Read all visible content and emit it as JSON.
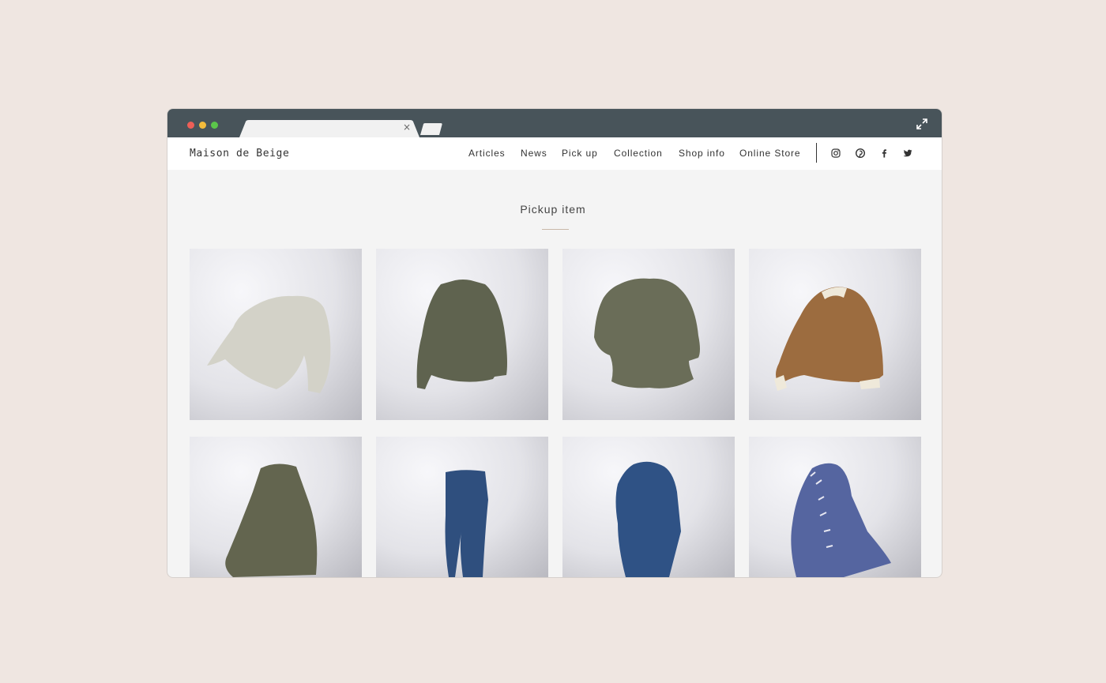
{
  "browser": {
    "tab_close_glyph": "×"
  },
  "site": {
    "brand": "Maison de Beige",
    "nav": [
      "Articles",
      "News",
      "Pick up",
      "Collection",
      "Shop info",
      "Online Store"
    ],
    "social_icons": [
      "instagram-icon",
      "pinterest-icon",
      "facebook-icon",
      "twitter-icon"
    ]
  },
  "section": {
    "title": "Pickup item"
  },
  "products": [
    {
      "name": "knit-sweater",
      "color": "#d3d2c8"
    },
    {
      "name": "khaki-jacket",
      "color": "#5f634f"
    },
    {
      "name": "khaki-blouse",
      "color": "#6a6d58"
    },
    {
      "name": "brown-bomber-jacket",
      "color": "#9c6c3f"
    },
    {
      "name": "khaki-skirt",
      "color": "#63654f"
    },
    {
      "name": "denim-jeans",
      "color": "#2f4f7e"
    },
    {
      "name": "denim-coat",
      "color": "#2f5285"
    },
    {
      "name": "striped-shirt-dress",
      "color": "#5565a0"
    }
  ]
}
